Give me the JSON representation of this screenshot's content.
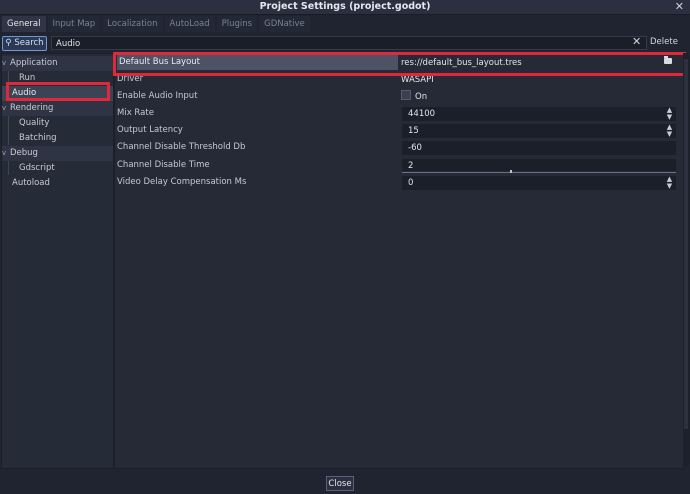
{
  "window": {
    "title": "Project Settings (project.godot)",
    "close_glyph": "✕"
  },
  "tabs": [
    {
      "label": "General",
      "active": true
    },
    {
      "label": "Input Map"
    },
    {
      "label": "Localization"
    },
    {
      "label": "AutoLoad"
    },
    {
      "label": "Plugins"
    },
    {
      "label": "GDNative"
    }
  ],
  "search": {
    "button_label": "Search",
    "value": "Audio",
    "clear_glyph": "✕",
    "delete_label": "Delete"
  },
  "tree": {
    "items": [
      {
        "label": "Application",
        "type": "category",
        "caret": "v"
      },
      {
        "label": "Run",
        "type": "child"
      },
      {
        "label": "Audio",
        "type": "child",
        "selected": true
      },
      {
        "label": "Rendering",
        "type": "category",
        "caret": "v"
      },
      {
        "label": "Quality",
        "type": "child"
      },
      {
        "label": "Batching",
        "type": "child"
      },
      {
        "label": "Debug",
        "type": "category",
        "caret": "v"
      },
      {
        "label": "Gdscript",
        "type": "child"
      },
      {
        "label": "Autoload",
        "type": "root"
      }
    ]
  },
  "properties": [
    {
      "name": "Default Bus Layout",
      "value": "res://default_bus_layout.tres",
      "icon": "folder-icon"
    },
    {
      "name": "Driver",
      "value": "WASAPI"
    },
    {
      "name": "Enable Audio Input",
      "value": "On",
      "checkbox": false
    },
    {
      "name": "Mix Rate",
      "value": "44100",
      "spinner": true
    },
    {
      "name": "Output Latency",
      "value": "15",
      "spinner": true
    },
    {
      "name": "Channel Disable Threshold Db",
      "value": "-60"
    },
    {
      "name": "Channel Disable Time",
      "value": "2"
    },
    {
      "name": "Video Delay Compensation Ms",
      "value": "0",
      "spinner": true
    }
  ],
  "footer": {
    "close_label": "Close"
  },
  "colors": {
    "highlight_box": "#e1283a",
    "search_accent": "#6e98d8",
    "background": "#1f2430"
  }
}
